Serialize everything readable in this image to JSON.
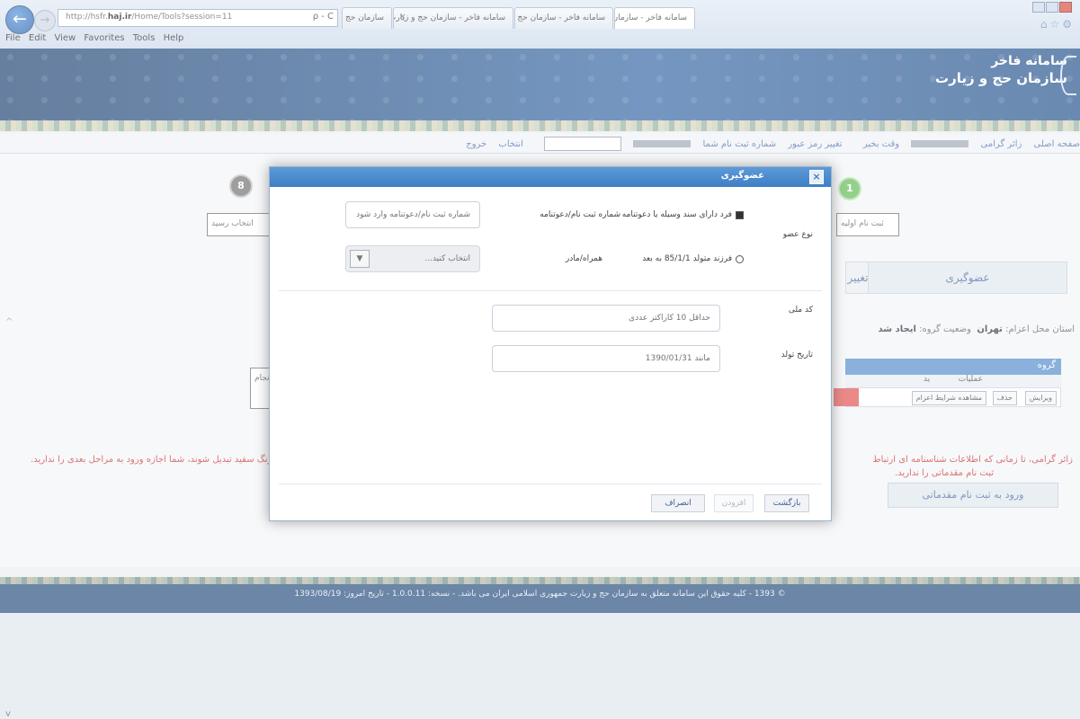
{
  "browser": {
    "url_prefix": "http://hsfr.",
    "url_host": "haj.ir",
    "url_path": "/Home/Tools?session=11",
    "addr_tools": "ρ - C",
    "tabs": [
      {
        "label": "سامانه فاخر - سازمان حج و زیارت"
      },
      {
        "label": "سامانه فاخر - سازمان حج و زیارت"
      },
      {
        "label": "سازمان حج و ز"
      }
    ],
    "menu": [
      "File",
      "Edit",
      "View",
      "Favorites",
      "Tools",
      "Help"
    ]
  },
  "brand": {
    "line1": "سامانه فاخر",
    "line2": "سازمان حج و زیارت"
  },
  "nav": {
    "items": [
      "صفحه اصلی",
      "زائر گرامی",
      "وقت بخیر",
      "تغییر رمز عبور",
      "شماره ثبت نام شما",
      "انتخاب",
      "خروج"
    ]
  },
  "page": {
    "step_left": "8",
    "step_right": "1",
    "stepbox_left": "انتخاب رسید",
    "stepbox_right": "ثبت نام اولیه",
    "stepbox_mid": "انجام",
    "tab_active": "عضوگیری",
    "tab_other": "تغییر ا",
    "info_prefix": "استان محل اعزام:",
    "info_province": "تهران",
    "info_status": "وضعیت گروه:",
    "info_status_val": "ایجاد شد",
    "grid_title": "گروه",
    "grid_ops": "عملیات",
    "grid_col2": "ید",
    "grid_btns": [
      "ویرایش",
      "حذف",
      "مشاهده شرایط اعزام"
    ],
    "warn_left": "به رنگ سفید تبدیل شوند، شما اجازه ورود به مراحل بعدی را ندارید.",
    "warn_right": "زائر گرامی، تا زمانی که اطلاعات شناسنامه ای ارتباط",
    "warn_right2": "ثبت نام مقدماتی را ندارید.",
    "enter_btn": "ورود به ثبت نام مقدماتی"
  },
  "footer": {
    "text": "© 1393 - کلیه حقوق این سامانه متعلق به سازمان حج و زیارت جمهوری اسلامی ایران می باشد.  -  نسخه: 1.0.0.11  -  تاریخ امروز: 1393/08/19"
  },
  "modal": {
    "title": "عضوگیری",
    "close": "×",
    "type_label": "نوع عضو",
    "opt1": "فرد دارای سند وسیله یا دعوتنامه",
    "opt2": "فرزند متولد 85/1/1 به بعد",
    "reg_label": "شماره ثبت نام/دعوتنامه",
    "reg_placeholder": "شماره ثبت نام/دعوتنامه وارد شود",
    "companion_label": "همراه/مادر",
    "companion_value": "انتخاب کنید...",
    "national_label": "کد ملی",
    "national_placeholder": "حداقل 10 کاراکتر عددی",
    "birth_label": "تاریخ تولد",
    "birth_placeholder": "مانند 1390/01/31",
    "btn_back": "بازگشت",
    "btn_add": "افزودن",
    "btn_cancel": "انصراف"
  },
  "colors": {
    "header": "#1d4a83",
    "modal_title": "#3e7ec4",
    "warn": "#c62828",
    "accent_green": "#5bb74f"
  }
}
